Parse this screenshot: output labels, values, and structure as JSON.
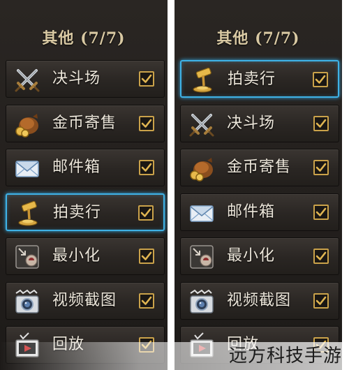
{
  "panels": [
    {
      "title": "其他 (7/7)",
      "items": [
        {
          "label": "决斗场",
          "icon": "crossed-swords-icon",
          "checked": true,
          "selected": false
        },
        {
          "label": "金币寄售",
          "icon": "coin-bag-icon",
          "checked": true,
          "selected": false
        },
        {
          "label": "邮件箱",
          "icon": "envelope-icon",
          "checked": true,
          "selected": false
        },
        {
          "label": "拍卖行",
          "icon": "gavel-icon",
          "checked": true,
          "selected": true
        },
        {
          "label": "最小化",
          "icon": "minimize-icon",
          "checked": true,
          "selected": false
        },
        {
          "label": "视频截图",
          "icon": "camera-icon",
          "checked": true,
          "selected": false
        },
        {
          "label": "回放",
          "icon": "replay-icon",
          "checked": true,
          "selected": false
        }
      ]
    },
    {
      "title": "其他 (7/7)",
      "items": [
        {
          "label": "拍卖行",
          "icon": "gavel-icon",
          "checked": true,
          "selected": true
        },
        {
          "label": "决斗场",
          "icon": "crossed-swords-icon",
          "checked": true,
          "selected": false
        },
        {
          "label": "金币寄售",
          "icon": "coin-bag-icon",
          "checked": true,
          "selected": false
        },
        {
          "label": "邮件箱",
          "icon": "envelope-icon",
          "checked": true,
          "selected": false
        },
        {
          "label": "最小化",
          "icon": "minimize-icon",
          "checked": true,
          "selected": false
        },
        {
          "label": "视频截图",
          "icon": "camera-icon",
          "checked": true,
          "selected": false
        },
        {
          "label": "回放",
          "icon": "replay-icon",
          "checked": true,
          "selected": false
        }
      ]
    }
  ],
  "watermark": "远方科技手游",
  "colors": {
    "selected_border": "#3fb2e6",
    "checkbox": "#caa24a",
    "label": "#ece6da",
    "title": "#d9c9a3"
  }
}
